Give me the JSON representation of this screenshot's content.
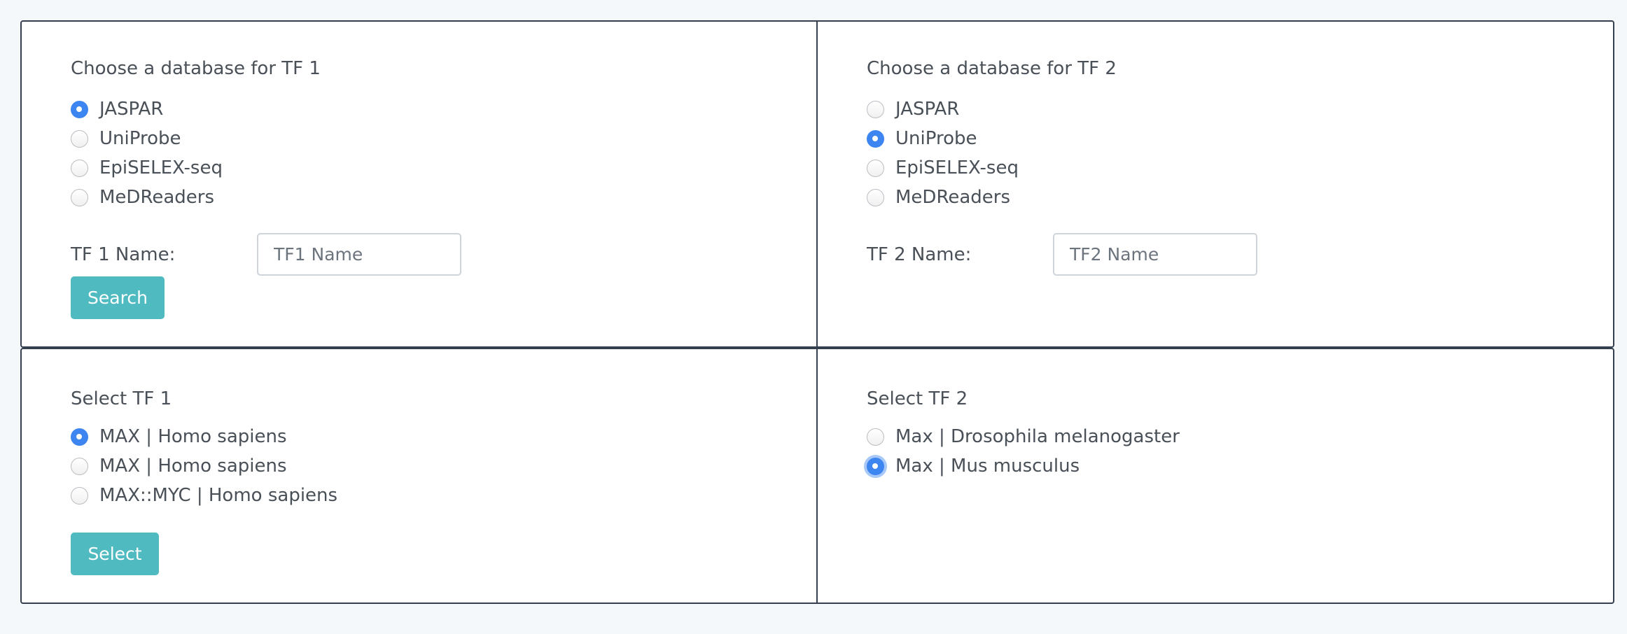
{
  "tf1_search": {
    "heading": "Choose a database for TF 1",
    "databases": [
      {
        "label": "JASPAR",
        "checked": true
      },
      {
        "label": "UniProbe",
        "checked": false
      },
      {
        "label": "EpiSELEX-seq",
        "checked": false
      },
      {
        "label": "MeDReaders",
        "checked": false
      }
    ],
    "name_label": "TF 1 Name:",
    "name_placeholder": "TF1 Name",
    "name_value": "",
    "search_button": "Search"
  },
  "tf2_search": {
    "heading": "Choose a database for TF 2",
    "databases": [
      {
        "label": "JASPAR",
        "checked": false
      },
      {
        "label": "UniProbe",
        "checked": true
      },
      {
        "label": "EpiSELEX-seq",
        "checked": false
      },
      {
        "label": "MeDReaders",
        "checked": false
      }
    ],
    "name_label": "TF 2 Name:",
    "name_placeholder": "TF2 Name",
    "name_value": ""
  },
  "tf1_select": {
    "heading": "Select TF 1",
    "options": [
      {
        "label": "MAX | Homo sapiens",
        "checked": true
      },
      {
        "label": "MAX | Homo sapiens",
        "checked": false
      },
      {
        "label": "MAX::MYC | Homo sapiens",
        "checked": false
      }
    ],
    "select_button": "Select"
  },
  "tf2_select": {
    "heading": "Select TF 2",
    "options": [
      {
        "label": "Max | Drosophila melanogaster",
        "checked": false
      },
      {
        "label": "Max | Mus musculus",
        "checked": true,
        "focused": true
      }
    ]
  },
  "colors": {
    "accent_radio": "#3d85f0",
    "button": "#4fbac0",
    "border": "#343f4f",
    "page_bg": "#f5f8fa",
    "text": "#495057"
  }
}
